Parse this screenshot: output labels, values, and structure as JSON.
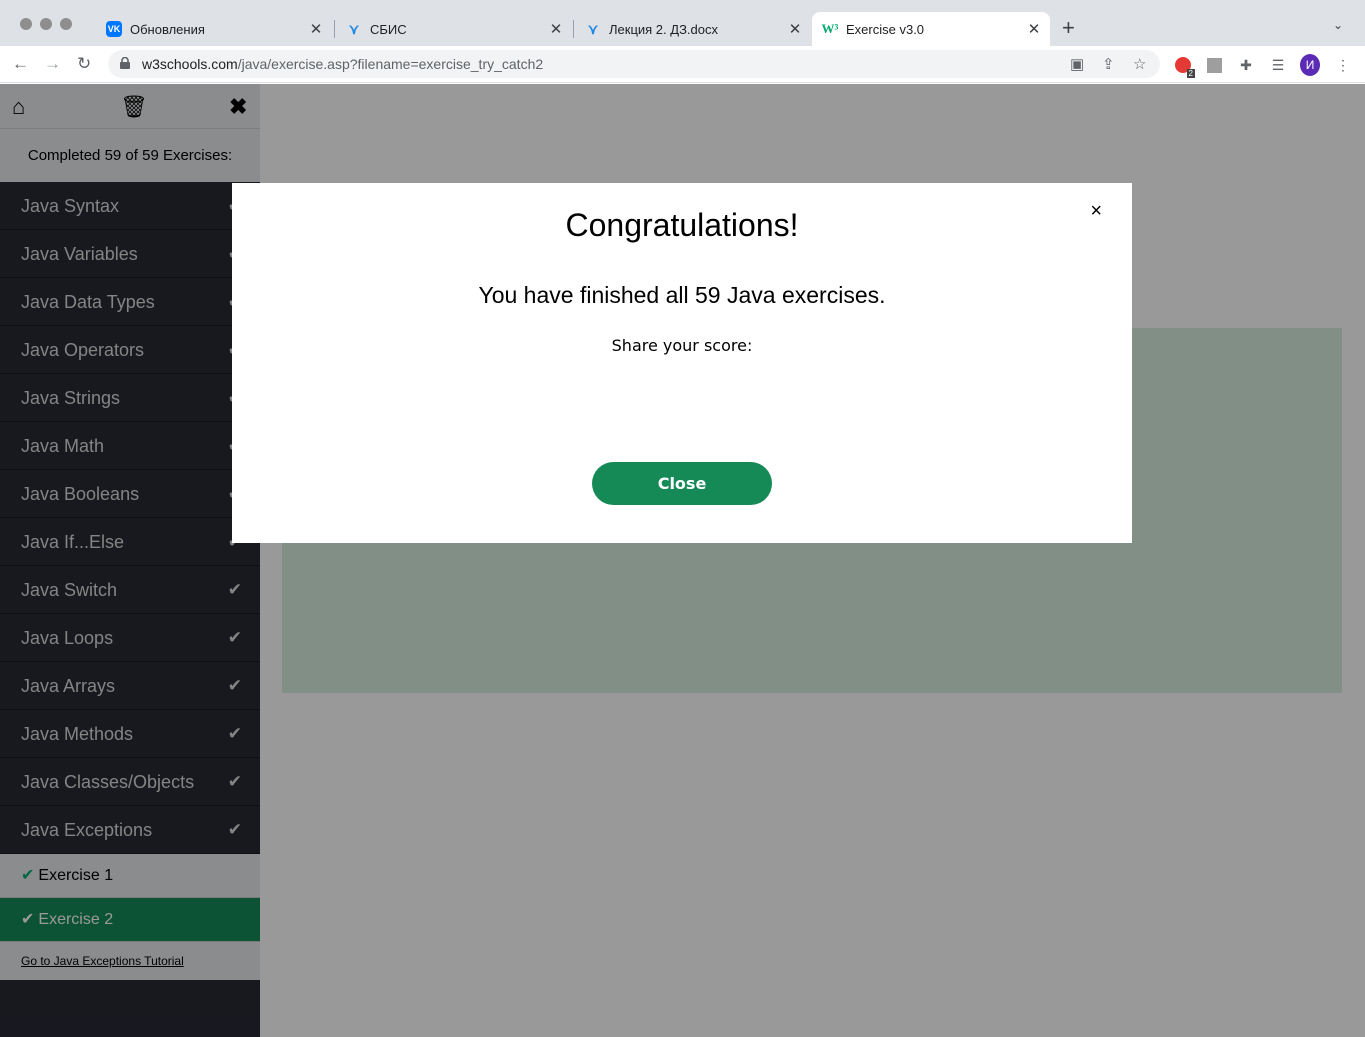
{
  "browser": {
    "tabs": [
      {
        "title": "Обновления",
        "favicon": "vk-icon",
        "color": "#0077ff"
      },
      {
        "title": "СБИС",
        "favicon": "sbis-icon",
        "color": "#1e88e5"
      },
      {
        "title": "Лекция 2. ДЗ.docx",
        "favicon": "sbis-icon",
        "color": "#1e88e5"
      },
      {
        "title": "Exercise v3.0",
        "favicon": "w3schools-icon",
        "color": "#04aa6d",
        "active": true
      }
    ],
    "url_host": "w3schools.com",
    "url_path": "/java/exercise.asp?filename=exercise_try_catch2",
    "adblock_badge": "2",
    "profile_initial": "И",
    "profile_color": "#5b2bb5"
  },
  "sidebar": {
    "status": "Completed 59 of 59 Exercises:",
    "items": [
      {
        "label": "Java Syntax"
      },
      {
        "label": "Java Variables"
      },
      {
        "label": "Java Data Types"
      },
      {
        "label": "Java Operators"
      },
      {
        "label": "Java Strings"
      },
      {
        "label": "Java Math"
      },
      {
        "label": "Java Booleans"
      },
      {
        "label": "Java If...Else"
      },
      {
        "label": "Java Switch"
      },
      {
        "label": "Java Loops"
      },
      {
        "label": "Java Arrays"
      },
      {
        "label": "Java Methods"
      },
      {
        "label": "Java Classes/Objects"
      },
      {
        "label": "Java Exceptions"
      }
    ],
    "subitems": [
      {
        "label": "Exercise 1"
      },
      {
        "label": "Exercise 2",
        "active": true
      }
    ],
    "tutorial_link": "Go to Java Exceptions Tutorial"
  },
  "modal": {
    "title": "Congratulations!",
    "message": "You have finished all 59 Java exercises.",
    "share": "Share your score:",
    "close_button": "Close",
    "close_icon": "×"
  },
  "colors": {
    "accent": "#04aa6d",
    "sidebar_bg": "#282a35",
    "close_button": "#168a56"
  }
}
